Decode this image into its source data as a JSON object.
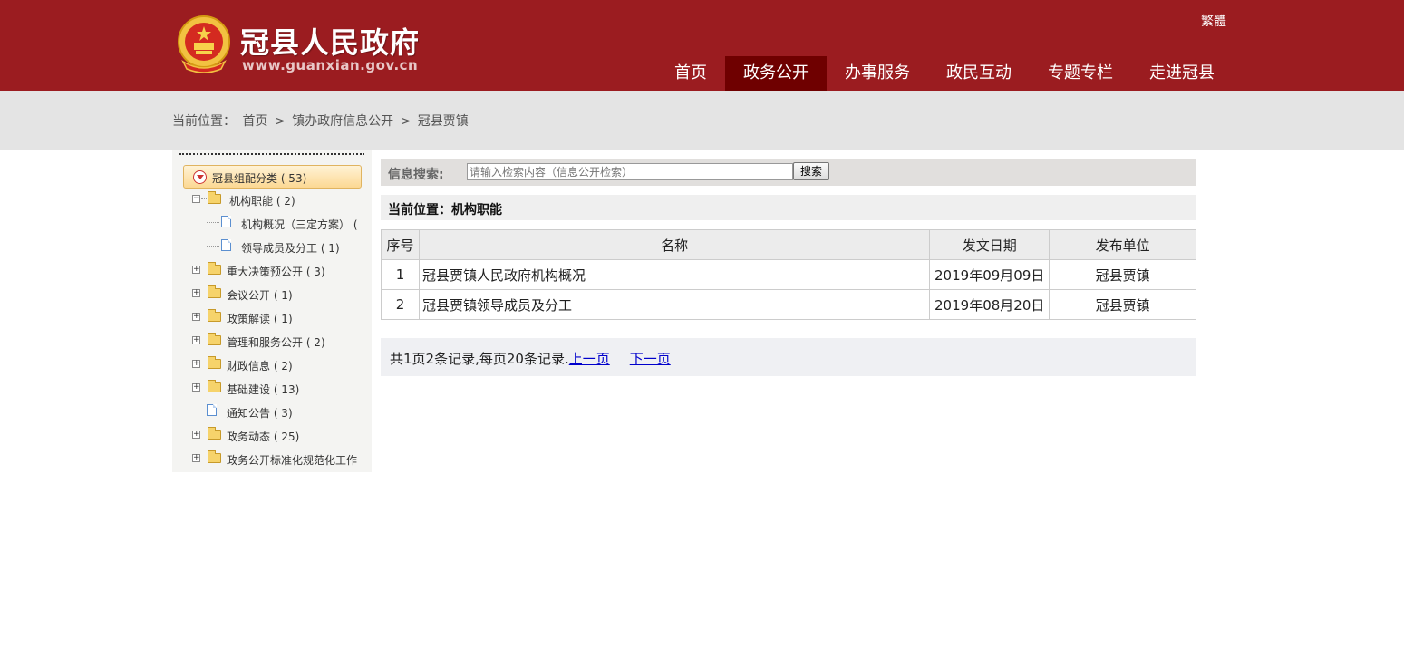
{
  "header": {
    "site_title": "冠县人民政府",
    "site_url": "www.guanxian.gov.cn",
    "lang_switch": "繁體",
    "nav": [
      {
        "label": "首页",
        "active": false
      },
      {
        "label": "政务公开",
        "active": true
      },
      {
        "label": "办事服务",
        "active": false
      },
      {
        "label": "政民互动",
        "active": false
      },
      {
        "label": "专题专栏",
        "active": false
      },
      {
        "label": "走进冠县",
        "active": false
      }
    ]
  },
  "breadcrumb": {
    "prefix": "当前位置：",
    "items": [
      "首页",
      ">",
      "镇办政府信息公开",
      ">",
      "冠县贾镇"
    ]
  },
  "sidebar": {
    "root": "冠县组配分类 ( 53)",
    "items": [
      {
        "label": "机构职能 ( 2)",
        "type": "folder-open"
      },
      {
        "label": "机构概况（三定方案） (",
        "type": "doc"
      },
      {
        "label": "领导成员及分工 ( 1)",
        "type": "doc"
      },
      {
        "label": "重大决策预公开 ( 3)",
        "type": "folder"
      },
      {
        "label": "会议公开 ( 1)",
        "type": "folder"
      },
      {
        "label": "政策解读 ( 1)",
        "type": "folder"
      },
      {
        "label": "管理和服务公开 ( 2)",
        "type": "folder"
      },
      {
        "label": "财政信息 ( 2)",
        "type": "folder"
      },
      {
        "label": "基础建设 ( 13)",
        "type": "folder"
      },
      {
        "label": "通知公告 ( 3)",
        "type": "doc-top"
      },
      {
        "label": "政务动态 ( 25)",
        "type": "folder"
      },
      {
        "label": "政务公开标准化规范化工作",
        "type": "folder"
      }
    ]
  },
  "search": {
    "label": "信息搜索:",
    "placeholder": "请输入检索内容（信息公开检索）",
    "button": "搜索"
  },
  "position": {
    "text": "当前位置：机构职能"
  },
  "table": {
    "headers": [
      "序号",
      "名称",
      "发文日期",
      "发布单位"
    ],
    "rows": [
      [
        "1",
        "冠县贾镇人民政府机构概况",
        "2019年09月09日",
        "冠县贾镇"
      ],
      [
        "2",
        "冠县贾镇领导成员及分工",
        "2019年08月20日",
        "冠县贾镇"
      ]
    ]
  },
  "pager": {
    "summary": "共1页2条记录,每页20条记录.",
    "prev": "上一页",
    "next": "下一页"
  },
  "colors": {
    "header_bg": "#9b1c20",
    "nav_active_bg": "#6f0000",
    "crumb_bg": "#e4e4e4"
  }
}
